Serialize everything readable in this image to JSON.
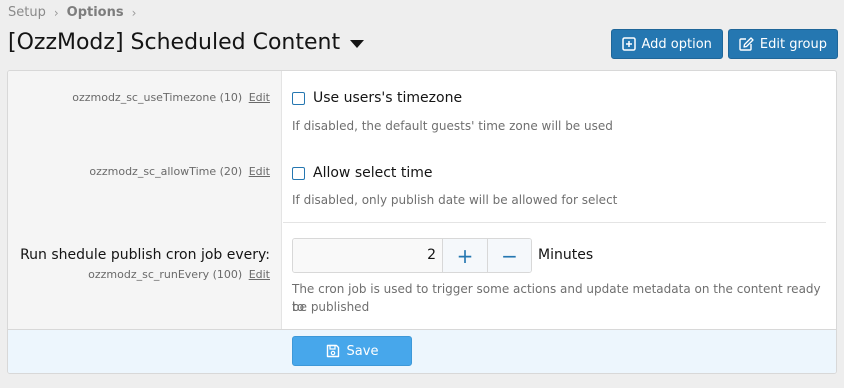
{
  "breadcrumb": {
    "items": [
      "Setup",
      "Options"
    ],
    "separator": "›"
  },
  "page": {
    "title": "[OzzModz] Scheduled Content"
  },
  "actions": {
    "add_option": "Add option",
    "edit_group": "Edit group"
  },
  "options": {
    "use_timezone": {
      "id_text": "ozzmodz_sc_useTimezone (10)",
      "edit": "Edit",
      "label": "Use users's timezone",
      "hint": "If disabled, the default guests' time zone will be used",
      "checked": false
    },
    "allow_time": {
      "id_text": "ozzmodz_sc_allowTime (20)",
      "edit": "Edit",
      "label": "Allow select time",
      "hint": "If disabled, only publish date will be allowed for select",
      "checked": false
    },
    "run_every": {
      "label": "Run shedule publish cron job every:",
      "id_text": "ozzmodz_sc_runEvery (100)",
      "edit": "Edit",
      "value": "2",
      "plus": "+",
      "minus": "−",
      "unit": "Minutes",
      "hint_line1": "The cron job is used to trigger some actions and update metadata on the content ready to",
      "hint_line2": "be published"
    }
  },
  "footer": {
    "save_label": "Save"
  },
  "colors": {
    "primary": "#2577b1",
    "save": "#47a7eb",
    "background": "#eeeeee",
    "footer_bg": "#edf6fd"
  },
  "icons": {
    "add_option": "plus-square-icon",
    "edit_group": "edit-square-icon",
    "save": "save-icon",
    "title_menu": "caret-down-icon"
  }
}
